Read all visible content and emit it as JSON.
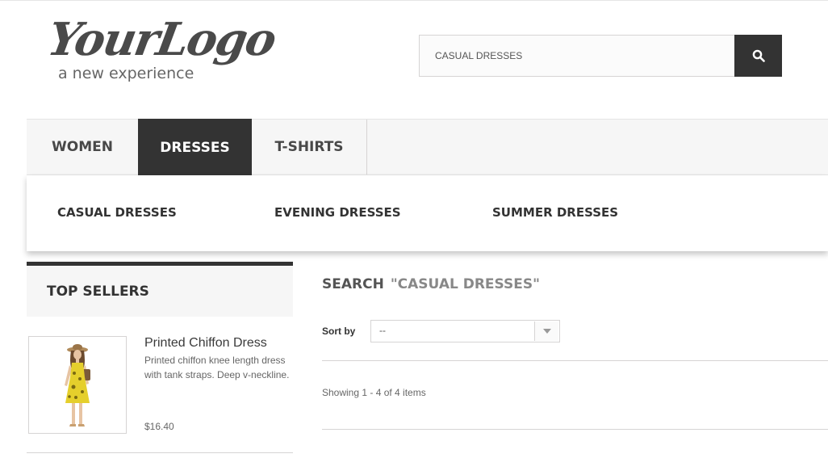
{
  "logo": {
    "main": "YourLogo",
    "tagline": "a new experience"
  },
  "search": {
    "value": "CASUAL DRESSES",
    "button_icon": "search-icon"
  },
  "menu": {
    "items": [
      {
        "label": "WOMEN",
        "active": false
      },
      {
        "label": "DRESSES",
        "active": true
      },
      {
        "label": "T-SHIRTS",
        "active": false
      }
    ]
  },
  "submenu": {
    "items": [
      {
        "label": "CASUAL DRESSES"
      },
      {
        "label": "EVENING DRESSES"
      },
      {
        "label": "SUMMER DRESSES"
      }
    ]
  },
  "sidebar": {
    "title": "TOP SELLERS",
    "product": {
      "name": "Printed Chiffon Dress",
      "description": "Printed chiffon knee length dress with tank straps. Deep v-neckline.",
      "price": "$16.40"
    }
  },
  "main": {
    "heading": "SEARCH",
    "term": "\"CASUAL DRESSES\"",
    "sort_label": "Sort by",
    "sort_value": "--",
    "showing": "Showing 1 - 4 of 4 items"
  },
  "colors": {
    "dark": "#333333",
    "menu_bg": "#f6f6f6",
    "border": "#d6d4d4"
  }
}
